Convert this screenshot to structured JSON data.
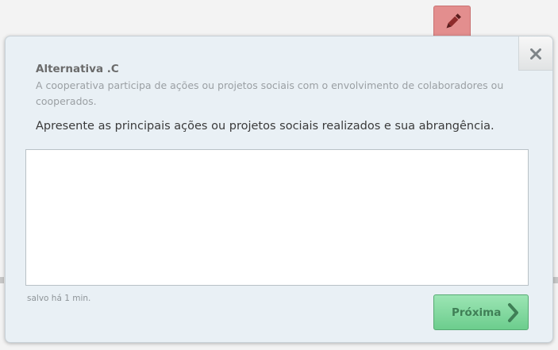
{
  "icons": {
    "edit": "pencil-icon",
    "close": "close-icon",
    "next": "chevron-right-icon"
  },
  "colors": {
    "edit_tab": "#e38e8e",
    "modal_bg": "#e9f0f5",
    "next_button": "#7fd79d"
  },
  "section": {
    "title": "Alternativa .C",
    "description": "A cooperativa participa de ações ou projetos sociais com o envolvimento de colaboradores ou cooperados."
  },
  "question": "Apresente as principais ações ou projetos sociais realizados e sua abrangência.",
  "answer": {
    "value": ""
  },
  "status": {
    "saved": "salvo há 1 min."
  },
  "buttons": {
    "next": "Próxima"
  }
}
